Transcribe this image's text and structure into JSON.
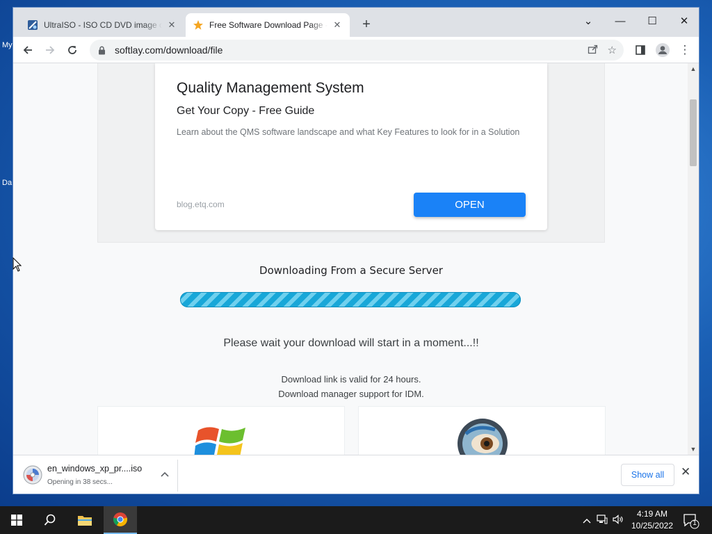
{
  "desktop": {
    "fragments": [
      "My",
      "Da"
    ]
  },
  "tabs": [
    {
      "title": "UltraISO - ISO CD DVD image creator",
      "icon": "ultraiso-icon"
    },
    {
      "title": "Free Software Download Page - Softlay",
      "icon": "star-icon"
    }
  ],
  "window_controls": {
    "menu": "⌄",
    "minimize": "—",
    "maximize": "☐",
    "close": "✕"
  },
  "address_bar": {
    "url": "softlay.com/download/file"
  },
  "ad": {
    "title": "Quality Management System",
    "subtitle": "Get Your Copy - Free Guide",
    "description": "Learn about the QMS software landscape and what Key Features to look for in a Solution",
    "domain": "blog.etq.com",
    "cta": "OPEN"
  },
  "download_section": {
    "heading": "Downloading From a Secure Server",
    "progress_percent": 100,
    "wait_text": "Please wait your download will start in a moment...!!",
    "valid_text": "Download link is valid for 24 hours.",
    "manager_text": "Download manager support for IDM."
  },
  "download_shelf": {
    "filename": "en_windows_xp_pr....iso",
    "status": "Opening in 38 secs...",
    "show_all": "Show all"
  },
  "taskbar": {
    "time": "4:19 AM",
    "date": "10/25/2022",
    "notification_count": "1"
  },
  "colors": {
    "accent": "#1a82f7",
    "progress": "#18a7d8",
    "taskbar": "#1b1b1b"
  }
}
